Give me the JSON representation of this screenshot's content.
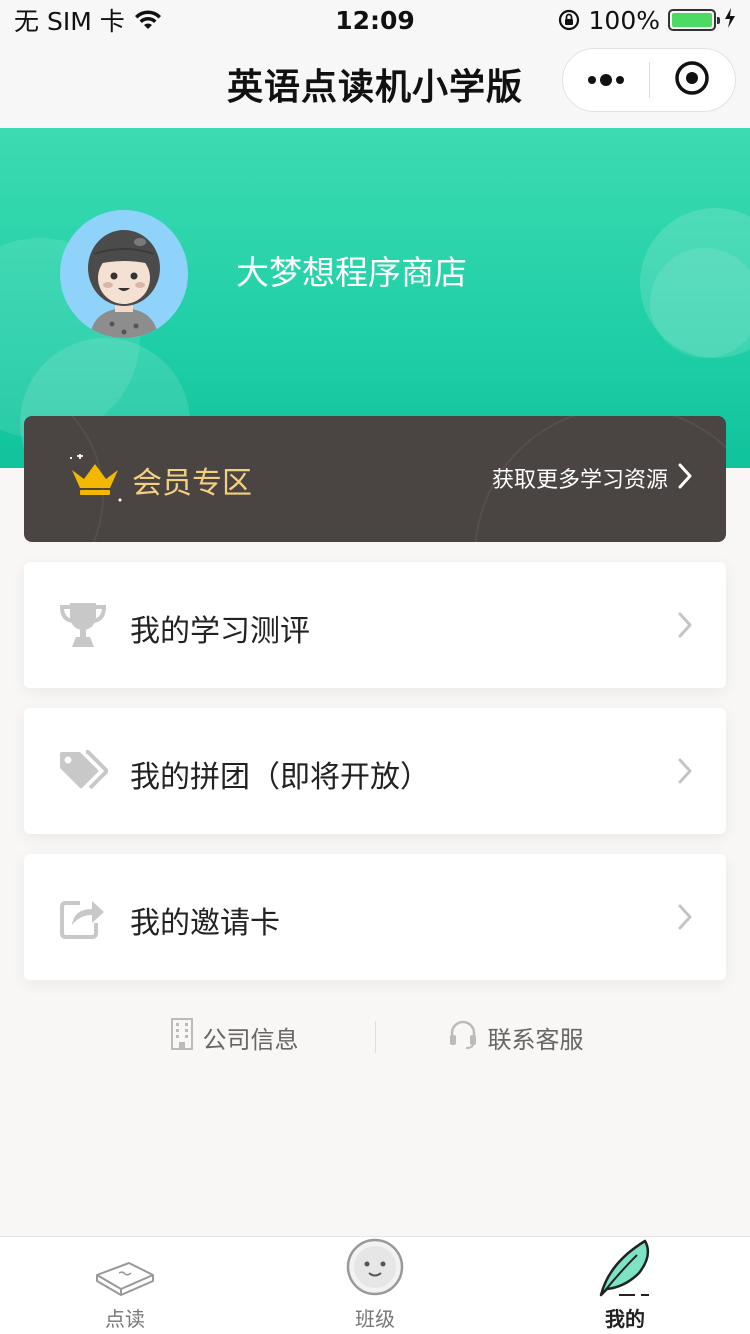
{
  "status_bar": {
    "carrier": "无 SIM 卡",
    "time": "12:09",
    "battery": "100%",
    "battery_level": 1.0
  },
  "nav": {
    "title": "英语点读机小学版",
    "more_icon": "more-dots-icon",
    "close_icon": "target-circle-icon"
  },
  "profile": {
    "username": "大梦想程序商店",
    "avatar_icon": "girl-avatar"
  },
  "member": {
    "title": "会员专区",
    "link_text": "获取更多学习资源",
    "accent": "#f3cf82",
    "bg": "#4a4542"
  },
  "menu": [
    {
      "label": "我的学习测评",
      "icon": "trophy-icon"
    },
    {
      "label": "我的拼团（即将开放）",
      "icon": "tags-icon"
    },
    {
      "label": "我的邀请卡",
      "icon": "share-icon"
    }
  ],
  "footer": {
    "company": "公司信息",
    "service": "联系客服"
  },
  "tabs": [
    {
      "label": "点读",
      "icon": "book-icon",
      "active": false
    },
    {
      "label": "班级",
      "icon": "smiley-face-icon",
      "active": false
    },
    {
      "label": "我的",
      "icon": "feather-icon",
      "active": true
    }
  ],
  "colors": {
    "header_green": "#20cfa7",
    "tab_active": "#222222"
  }
}
